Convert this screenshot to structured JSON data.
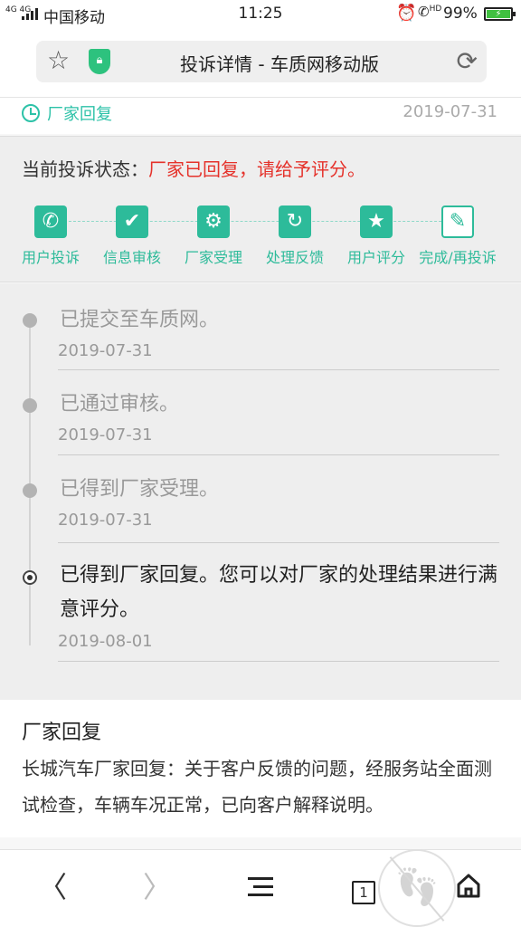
{
  "status_bar": {
    "network": "4G 4G",
    "carrier": "中国移动",
    "time": "11:25",
    "alarm_icon": "alarm-clock-icon",
    "hd_label": "HD",
    "battery": "99%"
  },
  "address_bar": {
    "title": "投诉详情 - 车质网移动版",
    "star_icon": "star-outline-icon",
    "security_icon": "green-shield-lock-icon",
    "reload_icon": "reload-icon"
  },
  "reply_header": {
    "label": "厂家回复",
    "date": "2019-07-31"
  },
  "status": {
    "label": "当前投诉状态：",
    "value": "厂家已回复，请给予评分。",
    "accent_color": "#e5322b"
  },
  "steps": [
    {
      "label": "用户投诉",
      "icon": "phone-icon"
    },
    {
      "label": "信息审核",
      "icon": "check-icon"
    },
    {
      "label": "厂家受理",
      "icon": "gear-icon"
    },
    {
      "label": "处理反馈",
      "icon": "refresh-icon"
    },
    {
      "label": "用户评分",
      "icon": "star-icon"
    },
    {
      "label": "完成/再投诉",
      "icon": "pen-icon"
    }
  ],
  "step_color": "#2dbb9a",
  "timeline": [
    {
      "text": "已提交至车质网。",
      "date": "2019-07-31"
    },
    {
      "text": "已通过审核。",
      "date": "2019-07-31"
    },
    {
      "text": "已得到厂家受理。",
      "date": "2019-07-31"
    },
    {
      "text": "已得到厂家回复。您可以对厂家的处理结果进行满意评分。",
      "date": "2019-08-01"
    }
  ],
  "reply": {
    "title": "厂家回复",
    "body": "长城汽车厂家回复：关于客户反馈的问题，经服务站全面测试检查，车辆车况正常，已向客户解释说明。"
  },
  "nav": {
    "back": "〈",
    "forward": "〉",
    "tabs_count": "1"
  }
}
